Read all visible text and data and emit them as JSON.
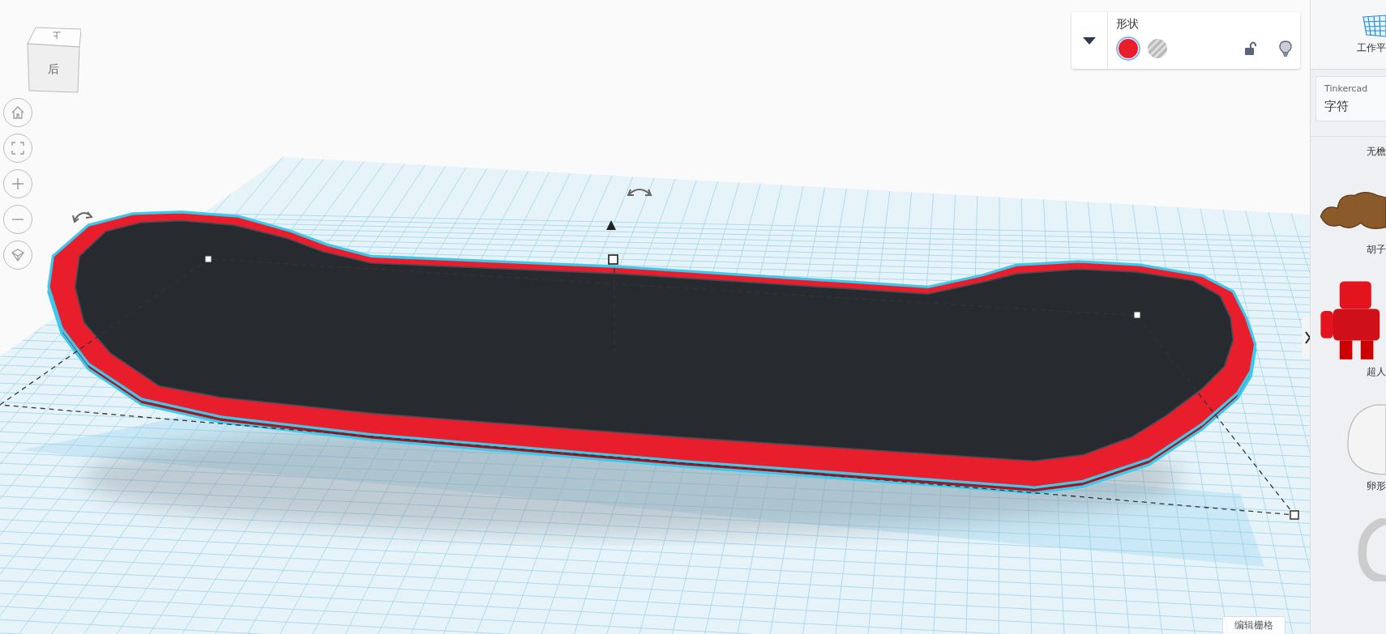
{
  "view_cube": {
    "front": "后",
    "top": "上"
  },
  "nav_buttons": [
    {
      "kind": "home"
    },
    {
      "kind": "fit"
    },
    {
      "kind": "zoom_in"
    },
    {
      "kind": "zoom_out"
    },
    {
      "kind": "perspective"
    }
  ],
  "shape_panel": {
    "title": "形状",
    "swatches": [
      {
        "kind": "solid",
        "color": "#e81e2d",
        "selected": true
      },
      {
        "kind": "hole",
        "selected": false
      }
    ],
    "locked": false
  },
  "edit_grid_button": "编辑栅格",
  "sidebar": {
    "workplane_button": "工作平",
    "library": {
      "source": "Tinkercad",
      "category": "字符"
    },
    "items": [
      {
        "kind": "none",
        "label": "无檐"
      },
      {
        "kind": "mustache",
        "label": "胡子"
      },
      {
        "kind": "robot",
        "label": "超人"
      },
      {
        "kind": "egg",
        "label": "卵形"
      },
      {
        "kind": "ring"
      }
    ]
  }
}
